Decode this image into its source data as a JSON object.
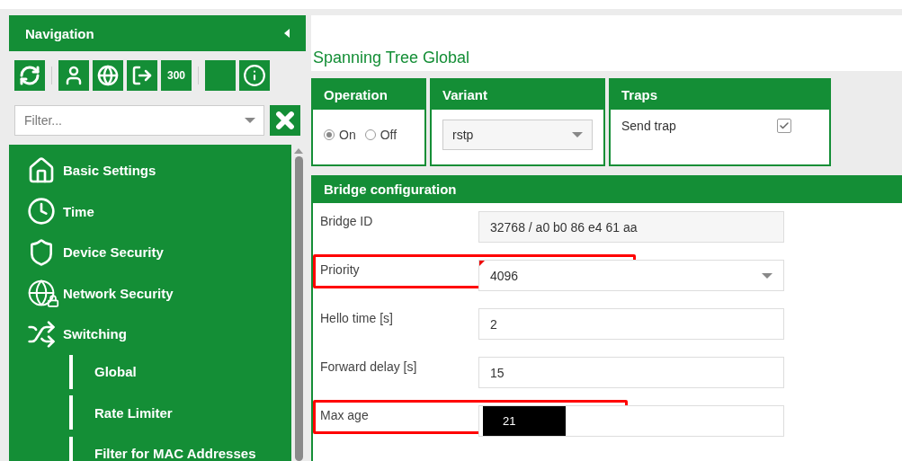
{
  "navigation": {
    "title": "Navigation",
    "toolbar": {
      "timer": "300"
    },
    "filter": {
      "placeholder": "Filter..."
    },
    "items": [
      {
        "label": "Basic Settings"
      },
      {
        "label": "Time"
      },
      {
        "label": "Device Security"
      },
      {
        "label": "Network Security"
      },
      {
        "label": "Switching",
        "children": [
          {
            "label": "Global"
          },
          {
            "label": "Rate Limiter"
          },
          {
            "label": "Filter for MAC Addresses"
          }
        ]
      }
    ]
  },
  "page": {
    "title": "Spanning Tree Global",
    "operation": {
      "title": "Operation",
      "options": [
        {
          "label": "On",
          "selected": true
        },
        {
          "label": "Off",
          "selected": false
        }
      ]
    },
    "variant": {
      "title": "Variant",
      "value": "rstp"
    },
    "traps": {
      "title": "Traps",
      "label": "Send trap",
      "checked": true
    },
    "bridge": {
      "title": "Bridge configuration",
      "rows": [
        {
          "label": "Bridge ID",
          "kind": "readonly",
          "value": "32768 / a0 b0 86 e4 61 aa",
          "highlighted": false,
          "masked": false
        },
        {
          "label": "Priority",
          "kind": "select",
          "value": "4096",
          "highlighted": true,
          "masked": false
        },
        {
          "label": "Hello time [s]",
          "kind": "input",
          "value": "2",
          "highlighted": false,
          "masked": false
        },
        {
          "label": "Forward delay [s]",
          "kind": "input",
          "value": "15",
          "highlighted": false,
          "masked": false
        },
        {
          "label": "Max age",
          "kind": "input",
          "value": "21",
          "highlighted": true,
          "masked": true
        }
      ]
    }
  }
}
